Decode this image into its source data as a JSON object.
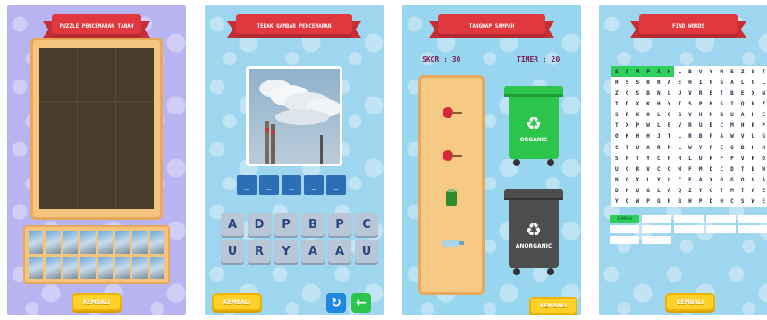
{
  "screens": [
    {
      "title": "PUZZLE PENCEMARAN TANAH",
      "back_label": "KEMBALI"
    },
    {
      "title": "TEBAK GAMBAR PENCEMARAN",
      "answer_slots": [
        "_",
        "_",
        "_",
        "_",
        "_"
      ],
      "letters": [
        "A",
        "D",
        "P",
        "B",
        "P",
        "C",
        "U",
        "R",
        "Y",
        "A",
        "A",
        "U"
      ],
      "back_label": "KEMBALI",
      "refresh_icon": "refresh-icon",
      "next_icon": "arrow-icon"
    },
    {
      "title": "TANGKAP SAMPAH",
      "score_label": "SKOR : 30",
      "timer_label": "TIMER : 20",
      "bins": [
        {
          "label": "ORGANIC",
          "color": "#2cc44a"
        },
        {
          "label": "ANORGANIC",
          "color": "#4d4d4d"
        }
      ],
      "back_label": "KEMBALI"
    },
    {
      "title": "FIND WORDS",
      "grid_rows": [
        "SAMPAHLBVYMEZST",
        "HSSRRAEHINGALGL",
        "ZCSBNLUVRETBEXN",
        "TDXKHYTSPMSTQNZ",
        "SRKOLOGVHMBUAHE",
        "TXPWLEVRUBCMHRP",
        "OKHHJTLRBPAWVUG",
        "CTUARMLWYPEGBHH",
        "SNTYCHHLURFPVRD",
        "UCRVCOWFMDCDTBW",
        "NGXLYLCEAXOGOVA",
        "DHUGLAQZYCTMTAE",
        "YQWPGNBHPDHCSWE"
      ],
      "words_found": [
        "SAMPAH"
      ],
      "word_slots_count": 12,
      "back_label": "KEMBALI"
    }
  ]
}
